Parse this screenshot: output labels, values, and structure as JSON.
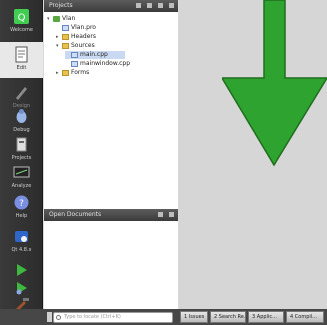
{
  "modebar": {
    "items": [
      {
        "label": "Welcome",
        "icon": "qt-logo-icon",
        "state": "normal"
      },
      {
        "label": "Edit",
        "icon": "document-edit-icon",
        "state": "active"
      },
      {
        "label": "Design",
        "icon": "design-pen-icon",
        "state": "disabled"
      },
      {
        "label": "Debug",
        "icon": "bug-icon",
        "state": "normal"
      },
      {
        "label": "Projects",
        "icon": "wrench-icon",
        "state": "normal"
      },
      {
        "label": "Analyze",
        "icon": "monitor-icon",
        "state": "normal"
      },
      {
        "label": "Help",
        "icon": "help-icon",
        "state": "normal"
      },
      {
        "label": "Qt 4.8.x",
        "icon": "kit-icon",
        "state": "normal"
      }
    ],
    "run_buttons": [
      "run-icon",
      "debug-run-icon",
      "build-hammer-icon"
    ]
  },
  "projects_pane": {
    "title": "Projects",
    "tree": [
      {
        "label": "Vlan",
        "kind": "project",
        "depth": 0,
        "toggle": "▾"
      },
      {
        "label": "Vlan.pro",
        "kind": "file",
        "depth": 1,
        "toggle": ""
      },
      {
        "label": "Headers",
        "kind": "folder",
        "depth": 1,
        "toggle": "▸"
      },
      {
        "label": "Sources",
        "kind": "folder",
        "depth": 1,
        "toggle": "▾"
      },
      {
        "label": "main.cpp",
        "kind": "file",
        "depth": 2,
        "toggle": "",
        "selected": true
      },
      {
        "label": "mainwindow.cpp",
        "kind": "file",
        "depth": 2,
        "toggle": ""
      },
      {
        "label": "Forms",
        "kind": "folder",
        "depth": 1,
        "toggle": "▸"
      }
    ]
  },
  "open_documents_pane": {
    "title": "Open Documents"
  },
  "annotation": {
    "color": "#2fa32f"
  },
  "status_bar": {
    "locator_placeholder": "Type to locate (Ctrl+K)",
    "tabs": [
      "1 Issues",
      "2 Search Re...",
      "3 Applic...",
      "4 Compil..."
    ]
  }
}
